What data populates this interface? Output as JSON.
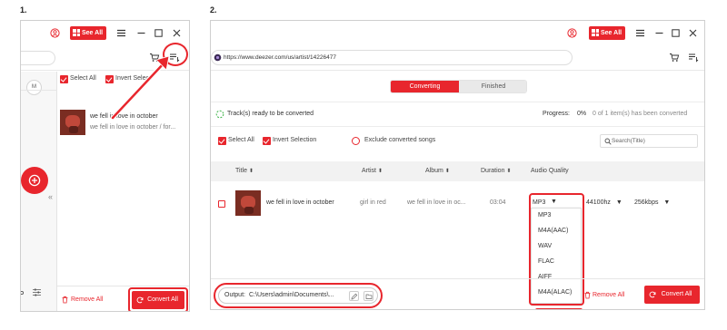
{
  "steps": {
    "one": "1.",
    "two": "2."
  },
  "panel1": {
    "see_all_label": "See All",
    "sidebar_avatar_letter": "M",
    "select_all_label": "Select All",
    "invert_selection_label": "Invert Selecti",
    "track": {
      "title": "we fell in love in october",
      "subtitle": "we fell in love in october / for..."
    },
    "remove_all_label": "Remove All",
    "convert_all_label": "Convert All",
    "collapse_glyph": "«"
  },
  "panel2": {
    "see_all_label": "See All",
    "url": "https://www.deezer.com/us/artist/14226477",
    "tabs": {
      "converting": "Converting",
      "finished": "Finished"
    },
    "ready_text": "Track(s) ready to be converted",
    "progress_label": "Progress:",
    "progress_value": "0%",
    "converted_count": "0 of 1 item(s) has been converted",
    "select_all_label": "Select All",
    "invert_selection_label": "Invert Selection",
    "exclude_label": "Exclude converted songs",
    "search_placeholder": "Search(Title)",
    "columns": {
      "title": "Title",
      "artist": "Artist",
      "album": "Album",
      "duration": "Duration",
      "quality": "Audio Quality"
    },
    "track": {
      "title": "we fell in love in october",
      "artist": "girl in red",
      "album": "we fell in love in oc...",
      "duration": "03:04",
      "format": "MP3",
      "sample_rate": "44100hz",
      "bitrate": "256kbps"
    },
    "format_options": [
      "MP3",
      "M4A(AAC)",
      "WAV",
      "FLAC",
      "AIFF",
      "M4A(ALAC)"
    ],
    "output_label": "Output:",
    "output_path": "C:\\Users\\admin\\Documents\\...",
    "remove_all_label": "Remove All",
    "convert_all_label": "Convert All"
  },
  "colors": {
    "accent": "#e8262d",
    "header_bg": "#f2f2f2"
  }
}
